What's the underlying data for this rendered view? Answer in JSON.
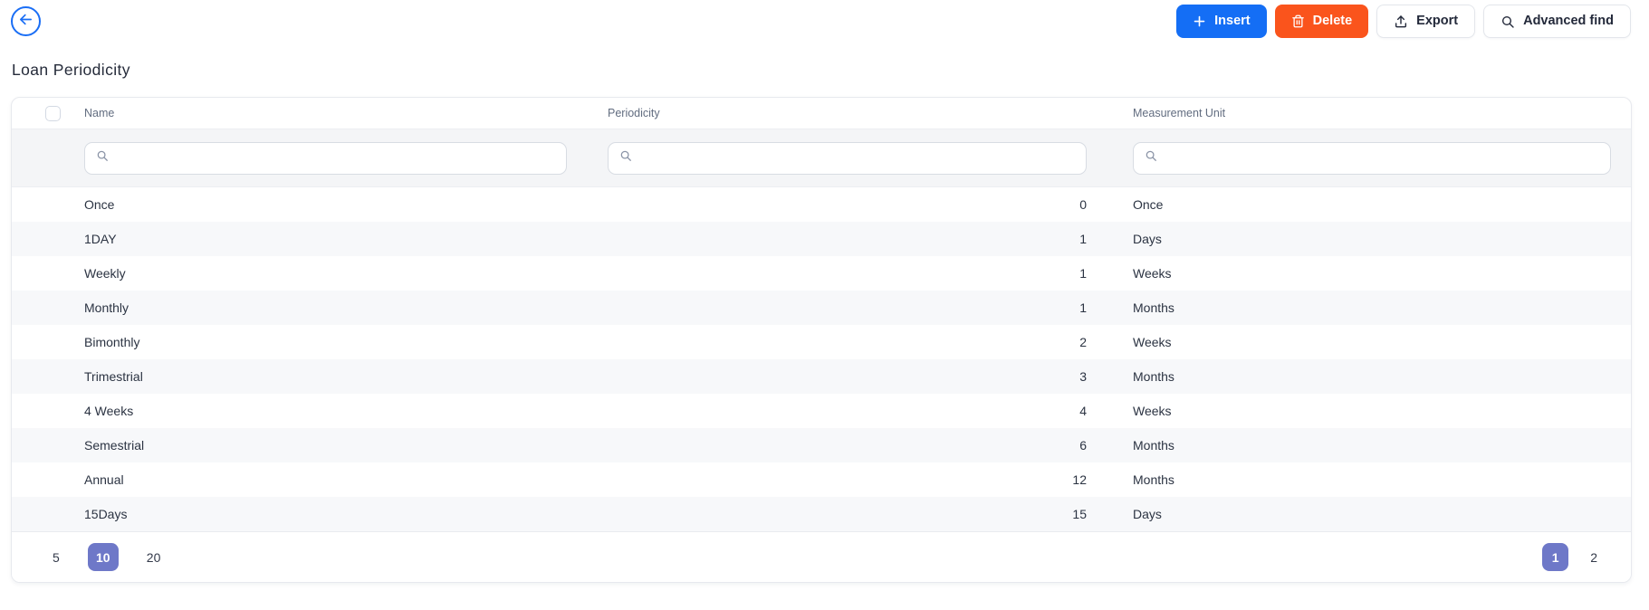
{
  "page": {
    "title": "Loan Periodicity"
  },
  "toolbar": {
    "insert_label": "Insert",
    "delete_label": "Delete",
    "export_label": "Export",
    "advanced_find_label": "Advanced find"
  },
  "table": {
    "columns": [
      {
        "label": "Name"
      },
      {
        "label": "Periodicity"
      },
      {
        "label": "Measurement Unit"
      }
    ],
    "filters": {
      "name_value": "",
      "periodicity_value": "",
      "unit_value": ""
    },
    "rows": [
      {
        "name": "Once",
        "periodicity": "0",
        "unit": "Once"
      },
      {
        "name": "1DAY",
        "periodicity": "1",
        "unit": "Days"
      },
      {
        "name": "Weekly",
        "periodicity": "1",
        "unit": "Weeks"
      },
      {
        "name": "Monthly",
        "periodicity": "1",
        "unit": "Months"
      },
      {
        "name": "Bimonthly",
        "periodicity": "2",
        "unit": "Weeks"
      },
      {
        "name": "Trimestrial",
        "periodicity": "3",
        "unit": "Months"
      },
      {
        "name": "4 Weeks",
        "periodicity": "4",
        "unit": "Weeks"
      },
      {
        "name": "Semestrial",
        "periodicity": "6",
        "unit": "Months"
      },
      {
        "name": "Annual",
        "periodicity": "12",
        "unit": "Months"
      },
      {
        "name": "15Days",
        "periodicity": "15",
        "unit": "Days"
      }
    ]
  },
  "pagination": {
    "page_sizes": [
      "5",
      "10",
      "20"
    ],
    "selected_page_size": "10",
    "pages": [
      "1",
      "2"
    ],
    "current_page": "1"
  },
  "icons": {
    "back": "arrow-left-icon",
    "insert": "plus-icon",
    "delete": "trash-icon",
    "export": "upload-icon",
    "advanced_find": "search-icon",
    "filter": "search-icon"
  },
  "colors": {
    "primary_blue": "#146ef5",
    "danger_orange": "#fa541c",
    "selected_indigo": "#6e78c8",
    "filter_row_bg": "#f4f5f7",
    "stripe_bg": "#f7f8fa"
  }
}
